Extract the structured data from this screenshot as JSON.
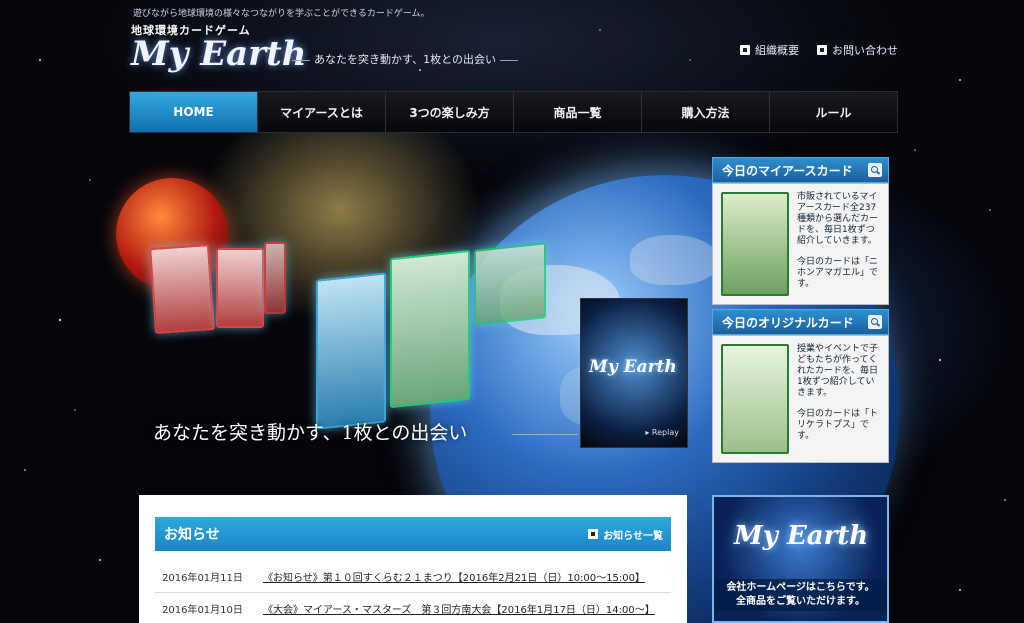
{
  "site": {
    "top_tagline": "遊びながら地球環境の様々なつながりを学ぶことができるカードゲーム。",
    "logo_subtitle": "地球環境カードゲーム",
    "logo_title": "My Earth",
    "header_catch": "あなたを突き動かす、1枚との出会い"
  },
  "util_links": [
    {
      "label": "組織概要",
      "icon": "square-bullet-icon"
    },
    {
      "label": "お問い合わせ",
      "icon": "square-bullet-icon"
    }
  ],
  "nav": [
    {
      "label": "HOME",
      "active": true
    },
    {
      "label": "マイアースとは"
    },
    {
      "label": "3つの楽しみ方"
    },
    {
      "label": "商品一覧"
    },
    {
      "label": "購入方法"
    },
    {
      "label": "ルール"
    }
  ],
  "hero": {
    "catch": "あなたを突き動かす、1枚との出会い",
    "video_logo": "My Earth",
    "replay_label": "▸ Replay"
  },
  "sidebar": {
    "card_of_day": {
      "title": "今日のマイアースカード",
      "text1": "市販されているマイアースカード全237種類から選んだカードを、毎日1枚ずつ紹介していきます。",
      "text2": "今日のカードは「ニホンアマガエル」です。"
    },
    "original_card": {
      "title": "今日のオリジナルカード",
      "text1": "授業やイベントで子どもたちが作ってくれたカードを、毎日1枚ずつ紹介していきます。",
      "text2": "今日のカードは「トリケラトプス」です。"
    },
    "banner": {
      "logo": "My Earth",
      "line1": "会社ホームページはこちらです。",
      "line2": "全商品をご覧いただけます。"
    }
  },
  "news": {
    "title": "お知らせ",
    "more_label": "お知らせ一覧",
    "items": [
      {
        "date": "2016年01月11日",
        "text": "《お知らせ》第１０回すくらむ２１まつり【2016年2月21日（日）10:00～15:00】"
      },
      {
        "date": "2016年01月10日",
        "text": "《大会》マイアース・マスターズ　第３回方南大会【2016年1月17日（日）14:00～】"
      }
    ]
  },
  "colors": {
    "accent_blue": "#1b86c4",
    "nav_active": "#36a9e0",
    "background": "#05060b"
  }
}
